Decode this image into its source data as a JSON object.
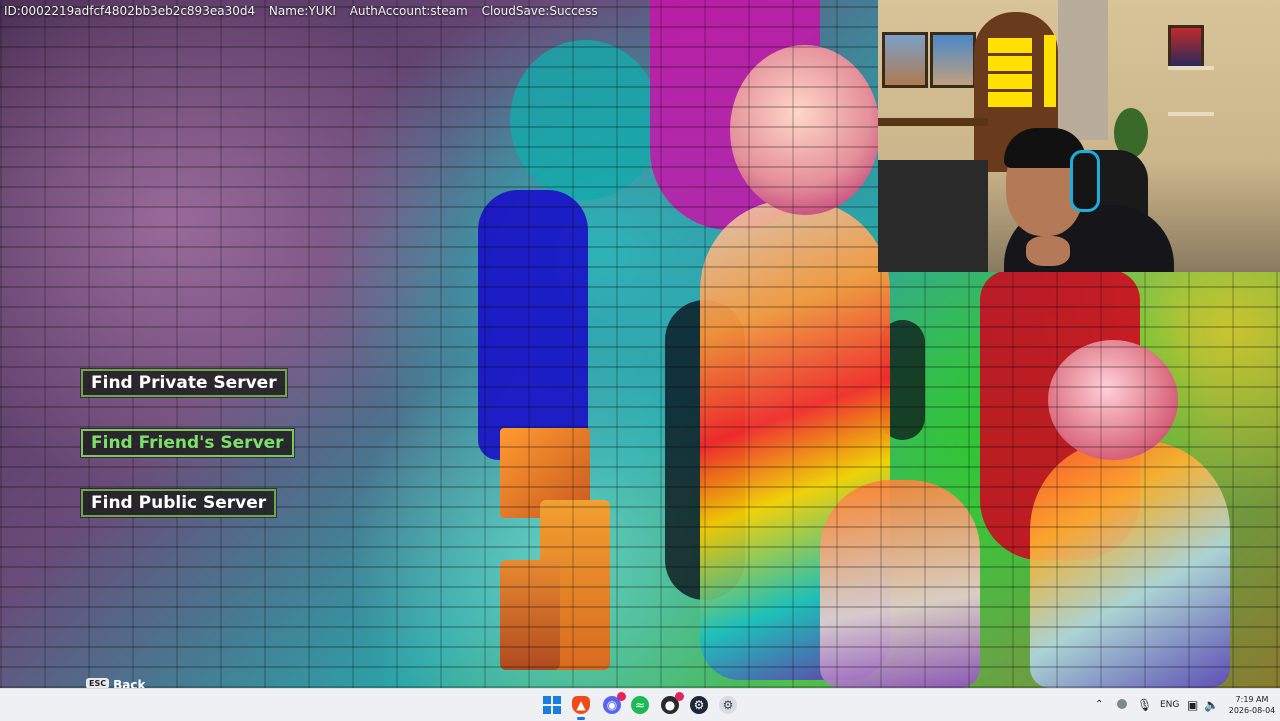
{
  "hud": {
    "id": "ID:0002219adfcf4802bb3eb2c893ea30d4",
    "name": "Name:YUKI",
    "auth": "AuthAccount:steam",
    "cloud": "CloudSave:Success"
  },
  "menu": {
    "private_label": "Find Private Server",
    "friend_label": "Find Friend's Server",
    "public_label": "Find Public Server",
    "selected": "Find Friend's Server",
    "accent_color": "#7de06a"
  },
  "back": {
    "key": "ESC",
    "label": "Back"
  },
  "webcam": {
    "description_icon": "webcam-person-icon"
  },
  "taskbar": {
    "icons": [
      "windows-start-icon",
      "brave-browser-icon",
      "discord-icon",
      "spotify-icon",
      "obs-icon",
      "steam-icon",
      "settings-icon"
    ],
    "lang": "ENG",
    "time": "7:19 AM",
    "date": "2026-08-04"
  }
}
